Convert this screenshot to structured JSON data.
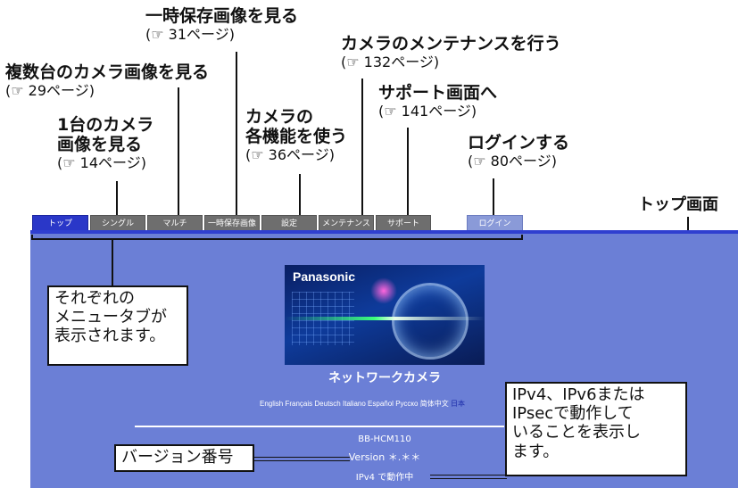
{
  "callouts": [
    {
      "id": "ichiji",
      "title": "一時保存画像を見る",
      "page": "(☞ 31ページ)"
    },
    {
      "id": "fukusu",
      "title": "複数台のカメラ画像を見る",
      "page": "(☞ 29ページ)"
    },
    {
      "id": "ichidai",
      "title_line1": "1台のカメラ",
      "title_line2": "画像を見る",
      "page": "(☞ 14ページ)"
    },
    {
      "id": "kakukino",
      "title_line1": "カメラの",
      "title_line2": "各機能を使う",
      "page": "(☞ 36ページ)"
    },
    {
      "id": "maintenance",
      "title": "カメラのメンテナンスを行う",
      "page": "(☞ 132ページ)"
    },
    {
      "id": "support",
      "title": "サポート画面へ",
      "page": "(☞ 141ページ)"
    },
    {
      "id": "login",
      "title": "ログインする",
      "page": "(☞ 80ページ)"
    }
  ],
  "top_screen_label": "トップ画面",
  "tabs": [
    {
      "label": "トップ",
      "active": true
    },
    {
      "label": "シングル"
    },
    {
      "label": "マルチ"
    },
    {
      "label": "一時保存画像"
    },
    {
      "label": "設定"
    },
    {
      "label": "メンテナンス"
    },
    {
      "label": "サポート"
    },
    {
      "label": "ログイン"
    }
  ],
  "banner": {
    "brand": "Panasonic"
  },
  "product_name": "ネットワークカメラ",
  "languages": [
    "English",
    "Français",
    "Deutsch",
    "Italiano",
    "Español",
    "Русско",
    "简体中文",
    "日本"
  ],
  "model": "BB-HCM110",
  "version": "Version ＊.＊＊",
  "ip_status": "IPv4 で動作中",
  "notes": {
    "menu_tabs": [
      "それぞれの",
      "メニュータブが",
      "表示されます。"
    ],
    "version_label": "バージョン番号",
    "ip_note": [
      "IPv4、IPv6または",
      "IPsecで動作して",
      "いることを表示し",
      "ます。"
    ]
  },
  "colors": {
    "panel": "#6b7fd6",
    "active_tab": "#2a37c8",
    "tab": "#6e6e6e",
    "login_tab": "#8a9ad8"
  }
}
